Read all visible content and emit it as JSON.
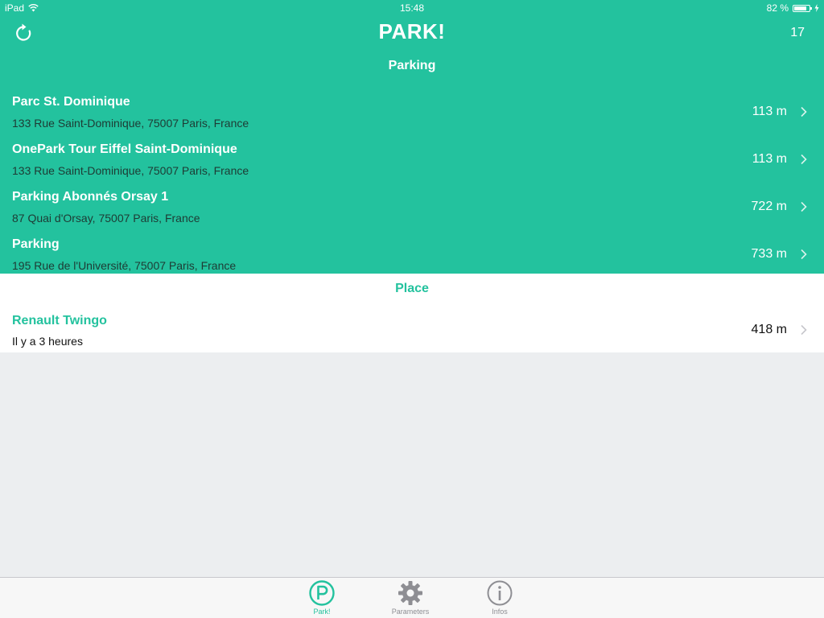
{
  "status_bar": {
    "device": "iPad",
    "time": "15:48",
    "battery": "82 %",
    "battery_level": 0.82
  },
  "nav": {
    "title": "PARK!",
    "right_value": "17"
  },
  "sections": {
    "parking": {
      "header": "Parking",
      "items": [
        {
          "name": "Parc St. Dominique",
          "address": "133 Rue Saint-Dominique, 75007 Paris, France",
          "distance": "113 m"
        },
        {
          "name": "OnePark Tour Eiffel Saint-Dominique",
          "address": "133 Rue Saint-Dominique, 75007 Paris, France",
          "distance": "113 m"
        },
        {
          "name": "Parking Abonnés Orsay 1",
          "address": "87 Quai d'Orsay, 75007 Paris, France",
          "distance": "722 m"
        },
        {
          "name": "Parking",
          "address": "195 Rue de l'Université, 75007 Paris, France",
          "distance": "733 m"
        }
      ]
    },
    "place": {
      "header": "Place",
      "items": [
        {
          "name": "Renault  Twingo",
          "address": "Il y a 3 heures",
          "distance": "418 m"
        }
      ]
    }
  },
  "tab_bar": {
    "tabs": [
      {
        "label": "Park!",
        "icon": "parking-icon",
        "active": true
      },
      {
        "label": "Parameters",
        "icon": "gear-icon",
        "active": false
      },
      {
        "label": "Infos",
        "icon": "info-icon",
        "active": false
      }
    ]
  },
  "colors": {
    "accent": "#23c29e",
    "background": "#eceef0",
    "tab_inactive": "#8e8e93"
  }
}
